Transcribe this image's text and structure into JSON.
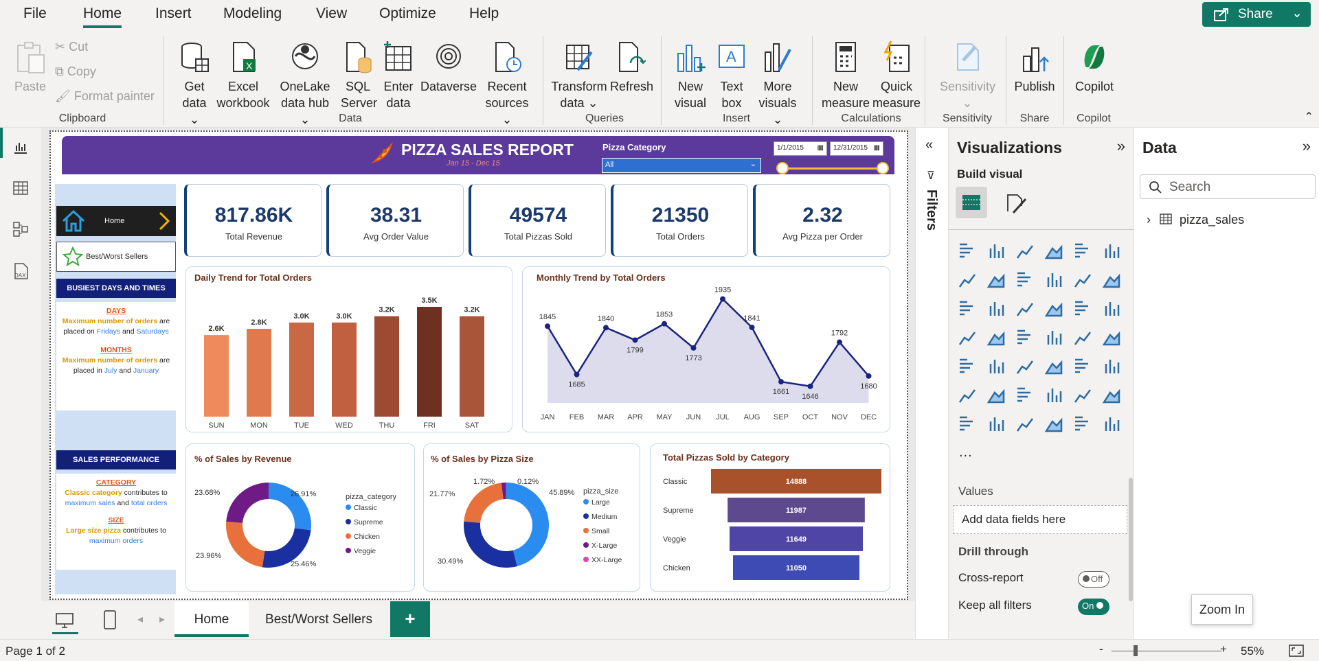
{
  "menu": {
    "items": [
      "File",
      "Home",
      "Insert",
      "Modeling",
      "View",
      "Optimize",
      "Help"
    ],
    "share": "Share"
  },
  "ribbon": {
    "paste": "Paste",
    "cut": "Cut",
    "copy": "Copy",
    "format_painter": "Format painter",
    "get_data": [
      "Get",
      "data"
    ],
    "excel": [
      "Excel",
      "workbook"
    ],
    "onelake": [
      "OneLake",
      "data hub"
    ],
    "sql": [
      "SQL",
      "Server"
    ],
    "enter_data": [
      "Enter",
      "data"
    ],
    "dataverse": "Dataverse",
    "recent": [
      "Recent",
      "sources"
    ],
    "transform": [
      "Transform",
      "data"
    ],
    "refresh": "Refresh",
    "new_visual": [
      "New",
      "visual"
    ],
    "text_box": [
      "Text",
      "box"
    ],
    "more_visuals": [
      "More",
      "visuals"
    ],
    "new_measure": [
      "New",
      "measure"
    ],
    "quick_measure": [
      "Quick",
      "measure"
    ],
    "sensitivity": "Sensitivity",
    "publish": "Publish",
    "copilot": "Copilot",
    "groups": [
      "Clipboard",
      "Data",
      "Queries",
      "Insert",
      "Calculations",
      "Sensitivity",
      "Share",
      "Copilot"
    ]
  },
  "report": {
    "title": "PIZZA SALES REPORT",
    "subtitle": "Jan 15 - Dec 15",
    "filter_label": "Pizza Category",
    "filter_value": "All",
    "date_start": "1/1/2015",
    "date_end": "12/31/2015",
    "nav_home": "Home",
    "nav_best": "Best/Worst Sellers",
    "sec1_title": "BUSIEST DAYS AND TIMES",
    "sec1": {
      "days_h": "DAYS",
      "days_a": "Maximum number of orders",
      "days_b": "are placed on",
      "days_c": "Fridays",
      "days_d": "and",
      "days_e": "Saturdays",
      "months_h": "MONTHS",
      "months_a": "Maximum number of orders",
      "months_b": "are placed in",
      "months_c": "July",
      "months_d": "and",
      "months_e": "January"
    },
    "sec2_title": "SALES PERFORMANCE",
    "sec2": {
      "cat_h": "CATEGORY",
      "cat_a": "Classic category",
      "cat_b": "contributes to",
      "cat_c": "maximum sales",
      "cat_d": "and",
      "cat_e": "total orders",
      "size_h": "SIZE",
      "size_a": "Large size pizza",
      "size_b": "contributes to",
      "size_c": "maximum orders"
    },
    "kpis": [
      {
        "value": "817.86K",
        "label": "Total Revenue"
      },
      {
        "value": "38.31",
        "label": "Avg Order Value"
      },
      {
        "value": "49574",
        "label": "Total Pizzas Sold"
      },
      {
        "value": "21350",
        "label": "Total Orders"
      },
      {
        "value": "2.32",
        "label": "Avg Pizza per Order"
      }
    ]
  },
  "chart_data": [
    {
      "type": "bar",
      "title": "Daily Trend for Total Orders",
      "categories": [
        "SUN",
        "MON",
        "TUE",
        "WED",
        "THU",
        "FRI",
        "SAT"
      ],
      "values": [
        2.6,
        2.8,
        3.0,
        3.0,
        3.2,
        3.5,
        3.2
      ],
      "labels": [
        "2.6K",
        "2.8K",
        "3.0K",
        "3.0K",
        "3.2K",
        "3.5K",
        "3.2K"
      ],
      "colors": [
        "#ee8a5b",
        "#e07a4e",
        "#c96845",
        "#c06040",
        "#9c4a32",
        "#6e3020",
        "#a8553a"
      ]
    },
    {
      "type": "area",
      "title": "Monthly Trend by Total Orders",
      "categories": [
        "JAN",
        "FEB",
        "MAR",
        "APR",
        "MAY",
        "JUN",
        "JUL",
        "AUG",
        "SEP",
        "OCT",
        "NOV",
        "DEC"
      ],
      "values": [
        1845,
        1685,
        1840,
        1799,
        1853,
        1773,
        1935,
        1841,
        1661,
        1646,
        1792,
        1680
      ],
      "ylim": [
        1600,
        1950
      ]
    },
    {
      "type": "pie",
      "title": "% of Sales by Revenue",
      "legend_title": "pizza_category",
      "series": [
        {
          "name": "Classic",
          "value": 26.91,
          "color": "#2b8cf0"
        },
        {
          "name": "Supreme",
          "value": 25.46,
          "color": "#1a2fa0"
        },
        {
          "name": "Chicken",
          "value": 23.96,
          "color": "#e8703a"
        },
        {
          "name": "Veggie",
          "value": 23.68,
          "color": "#6f1b86"
        }
      ],
      "labels": [
        "26.91%",
        "25.46%",
        "23.96%",
        "23.68%"
      ]
    },
    {
      "type": "pie",
      "title": "% of Sales by Pizza Size",
      "legend_title": "pizza_size",
      "series": [
        {
          "name": "Large",
          "value": 45.89,
          "color": "#2b8cf0"
        },
        {
          "name": "Medium",
          "value": 30.49,
          "color": "#1a2fa0"
        },
        {
          "name": "Small",
          "value": 21.77,
          "color": "#e8703a"
        },
        {
          "name": "X-Large",
          "value": 1.72,
          "color": "#6f1b86"
        },
        {
          "name": "XX-Large",
          "value": 0.12,
          "color": "#e044b0"
        }
      ],
      "labels": [
        "45.89%",
        "30.49%",
        "21.77%",
        "1.72%",
        "0.12%"
      ]
    },
    {
      "type": "bar",
      "title": "Total Pizzas Sold by Category",
      "categories": [
        "Classic",
        "Supreme",
        "Veggie",
        "Chicken"
      ],
      "values": [
        14888,
        11987,
        11649,
        11050
      ],
      "colors": [
        "#a9512b",
        "#5d4a8e",
        "#4f45a6",
        "#3f4bb5"
      ]
    }
  ],
  "panes": {
    "filters": "Filters",
    "viz_title": "Visualizations",
    "build_visual": "Build visual",
    "values": "Values",
    "add_fields": "Add data fields here",
    "drill": "Drill through",
    "cross_report": "Cross-report",
    "cross_state": "Off",
    "keep_filters": "Keep all filters",
    "keep_state": "On",
    "data_title": "Data",
    "search_placeholder": "Search",
    "table_name": "pizza_sales",
    "ellipsis": "..."
  },
  "tabs": {
    "home": "Home",
    "best": "Best/Worst Sellers",
    "add": "+"
  },
  "status": {
    "page": "Page 1 of 2",
    "zoom": "55%",
    "tooltip": "Zoom In"
  }
}
